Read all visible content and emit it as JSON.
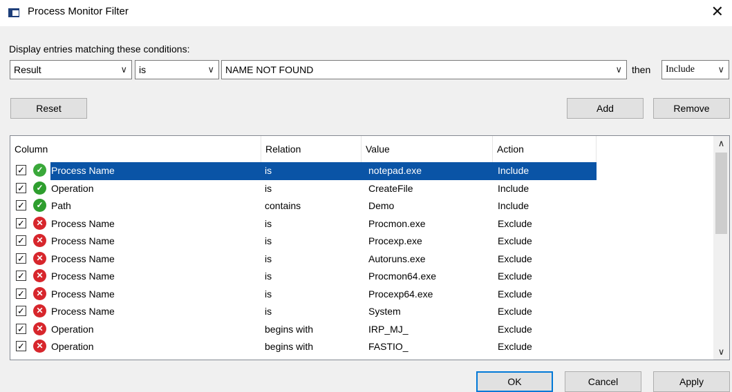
{
  "window": {
    "title": "Process Monitor Filter",
    "close_glyph": "✕"
  },
  "conditions_label": "Display entries matching these conditions:",
  "filter": {
    "column": "Result",
    "relation": "is",
    "value": "NAME NOT FOUND",
    "then_label": "then",
    "action": "Include"
  },
  "buttons": {
    "reset": "Reset",
    "add": "Add",
    "remove": "Remove",
    "ok": "OK",
    "cancel": "Cancel",
    "apply": "Apply"
  },
  "table": {
    "headers": [
      "Column",
      "Relation",
      "Value",
      "Action"
    ],
    "rows": [
      {
        "column": "Process Name",
        "relation": "is",
        "value": "notepad.exe",
        "action": "Include",
        "checked": true,
        "status": "include",
        "selected": true
      },
      {
        "column": "Operation",
        "relation": "is",
        "value": "CreateFile",
        "action": "Include",
        "checked": true,
        "status": "include"
      },
      {
        "column": "Path",
        "relation": "contains",
        "value": "Demo",
        "action": "Include",
        "checked": true,
        "status": "include"
      },
      {
        "column": "Process Name",
        "relation": "is",
        "value": "Procmon.exe",
        "action": "Exclude",
        "checked": true,
        "status": "exclude"
      },
      {
        "column": "Process Name",
        "relation": "is",
        "value": "Procexp.exe",
        "action": "Exclude",
        "checked": true,
        "status": "exclude"
      },
      {
        "column": "Process Name",
        "relation": "is",
        "value": "Autoruns.exe",
        "action": "Exclude",
        "checked": true,
        "status": "exclude"
      },
      {
        "column": "Process Name",
        "relation": "is",
        "value": "Procmon64.exe",
        "action": "Exclude",
        "checked": true,
        "status": "exclude"
      },
      {
        "column": "Process Name",
        "relation": "is",
        "value": "Procexp64.exe",
        "action": "Exclude",
        "checked": true,
        "status": "exclude"
      },
      {
        "column": "Process Name",
        "relation": "is",
        "value": "System",
        "action": "Exclude",
        "checked": true,
        "status": "exclude"
      },
      {
        "column": "Operation",
        "relation": "begins with",
        "value": "IRP_MJ_",
        "action": "Exclude",
        "checked": true,
        "status": "exclude"
      },
      {
        "column": "Operation",
        "relation": "begins with",
        "value": "FASTIO_",
        "action": "Exclude",
        "checked": true,
        "status": "exclude"
      }
    ]
  },
  "colors": {
    "selection": "#0a54a6",
    "include": "#2e9e2e",
    "exclude": "#d7262c",
    "default_button_border": "#0078d7"
  },
  "icons": {
    "include": "check-circle-icon",
    "exclude": "x-circle-icon",
    "dropdown": "chevron-down-icon"
  }
}
